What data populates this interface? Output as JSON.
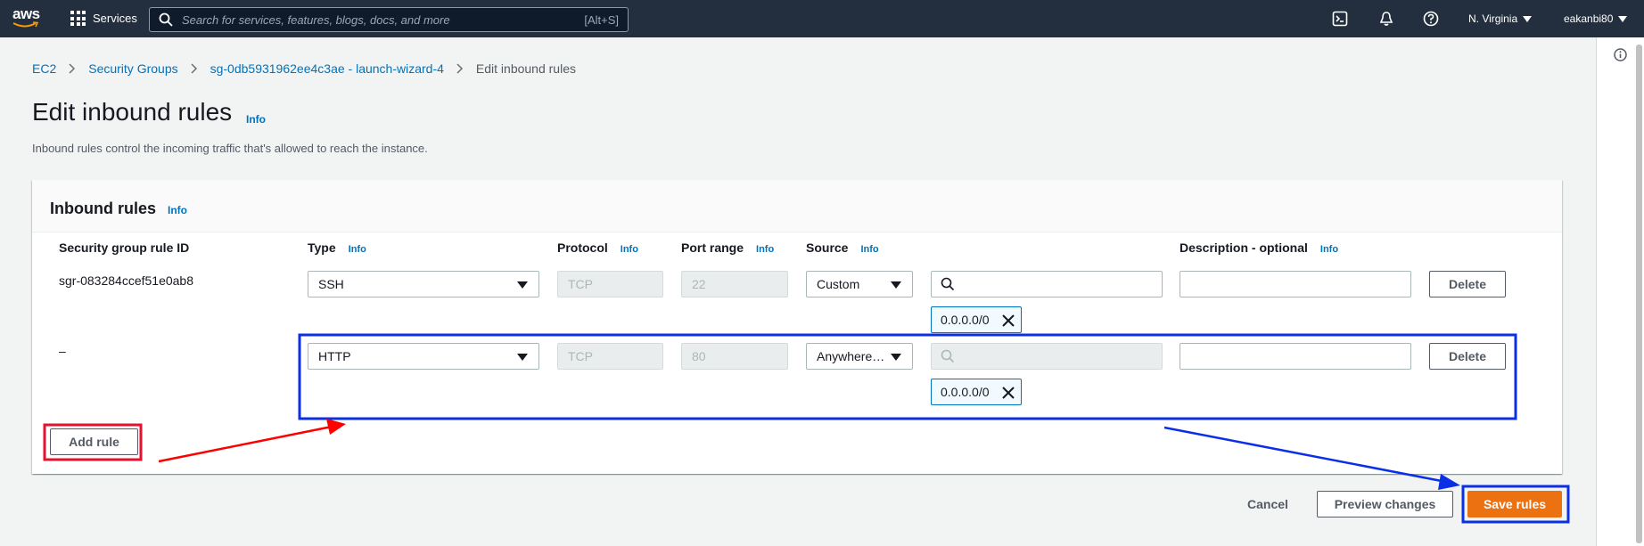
{
  "topnav": {
    "logo_text": "aws",
    "services_label": "Services",
    "search_placeholder": "Search for services, features, blogs, docs, and more",
    "search_shortcut": "[Alt+S]",
    "region": "N. Virginia",
    "user": "eakanbi80"
  },
  "breadcrumb": {
    "items": [
      "EC2",
      "Security Groups",
      "sg-0db5931962ee4c3ae - launch-wizard-4"
    ],
    "current": "Edit inbound rules"
  },
  "page": {
    "title": "Edit inbound rules",
    "title_info": "Info",
    "description": "Inbound rules control the incoming traffic that's allowed to reach the instance."
  },
  "panel": {
    "title": "Inbound rules",
    "info": "Info",
    "columns": {
      "rule_id": "Security group rule ID",
      "type": "Type",
      "protocol": "Protocol",
      "port_range": "Port range",
      "source": "Source",
      "description": "Description - optional",
      "info": "Info"
    },
    "rules": [
      {
        "rule_id": "sgr-083284ccef51e0ab8",
        "type": "SSH",
        "protocol": "TCP",
        "port_range": "22",
        "source": "Custom",
        "source_search": "",
        "cidr_token": "0.0.0.0/0",
        "description": "",
        "delete_label": "Delete"
      },
      {
        "rule_id": "–",
        "type": "HTTP",
        "protocol": "TCP",
        "port_range": "80",
        "source": "Anywhere…",
        "source_search": "",
        "cidr_token": "0.0.0.0/0",
        "description": "",
        "delete_label": "Delete"
      }
    ],
    "add_rule_label": "Add rule"
  },
  "footer": {
    "cancel_label": "Cancel",
    "preview_label": "Preview changes",
    "save_label": "Save rules"
  },
  "colors": {
    "nav_bg": "#232f3e",
    "link": "#0073bb",
    "primary": "#ec7211",
    "annotation_red": "#e8112d",
    "annotation_red_arrow": "#ff0000",
    "annotation_blue": "#0a2fe6"
  }
}
